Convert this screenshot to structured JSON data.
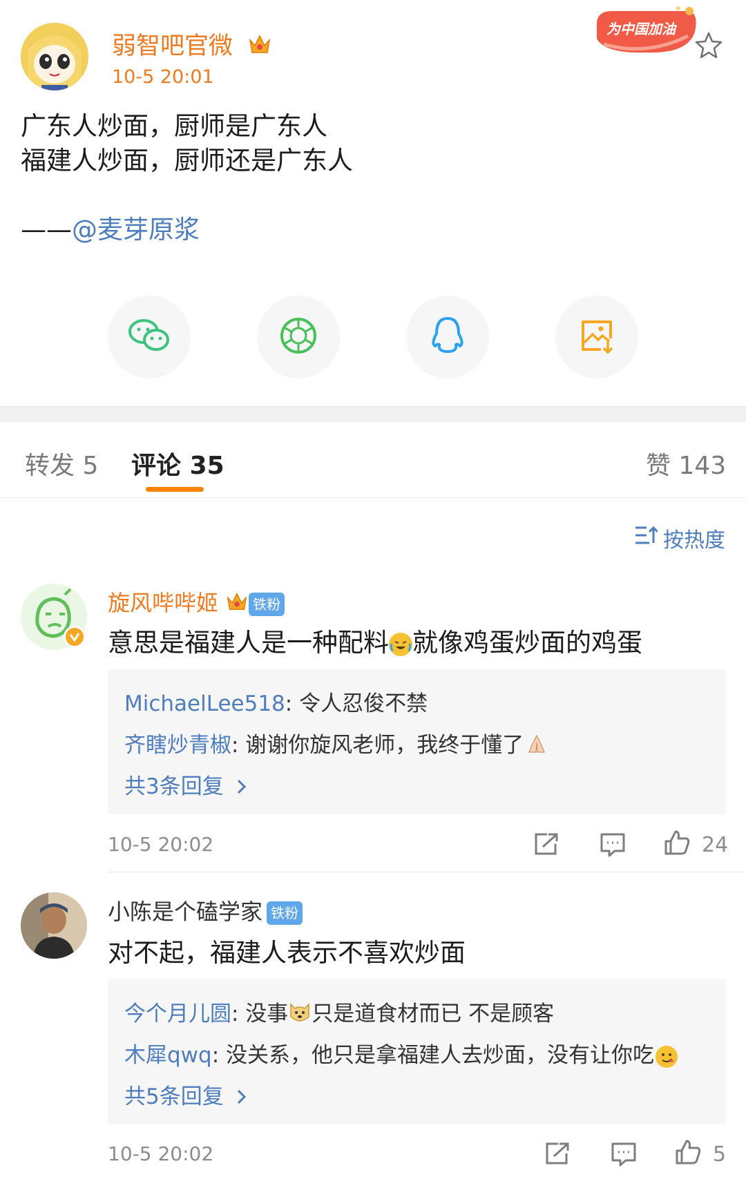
{
  "post": {
    "author": "弱智吧官微",
    "time": "10-5 20:01",
    "campaign_badge": "为中国加油",
    "lines": [
      "广东人炒面，厨师是广东人",
      "福建人炒面，厨师还是广东人"
    ],
    "attribution_prefix": "——",
    "attribution_mention": "@麦芽原浆",
    "share_targets": [
      "wechat-icon",
      "moments-icon",
      "qq-icon",
      "save-image-icon"
    ]
  },
  "tabs": [
    {
      "label": "转发",
      "count": "5"
    },
    {
      "label": "评论",
      "count": "35"
    },
    {
      "label": "赞",
      "count": "143"
    }
  ],
  "sort_label": "按热度",
  "comments": [
    {
      "name": "旋风哔哔姬",
      "fan_badge": "铁粉",
      "text_a": "意思是福建人是一种配料",
      "text_b": "就像鸡蛋炒面的鸡蛋",
      "replies": [
        {
          "name": "MichaelLee518",
          "text": ": 令人忍俊不禁"
        },
        {
          "name": "齐瞎炒青椒",
          "text": ": 谢谢你旋风老师，我终于懂了"
        }
      ],
      "more": "共3条回复",
      "time": "10-5 20:02",
      "likes": "24"
    },
    {
      "name": "小陈是个磕学家",
      "fan_badge": "铁粉",
      "text_a": "对不起，福建人表示不喜欢炒面",
      "text_b": "",
      "replies": [
        {
          "name": "今个月儿圆",
          "text": ": 没事",
          "text_2": "只是道食材而已 不是顾客"
        },
        {
          "name": "木犀qwq",
          "text": ": 没关系，他只是拿福建人去炒面，没有让你吃"
        }
      ],
      "more": "共5条回复",
      "time": "10-5 20:02",
      "likes": "5"
    }
  ],
  "colors": {
    "accent_orange": "#ff8200",
    "author_orange": "#f07a1f",
    "link_blue": "#4e7dbd",
    "badge_blue": "#5fa6ea"
  }
}
